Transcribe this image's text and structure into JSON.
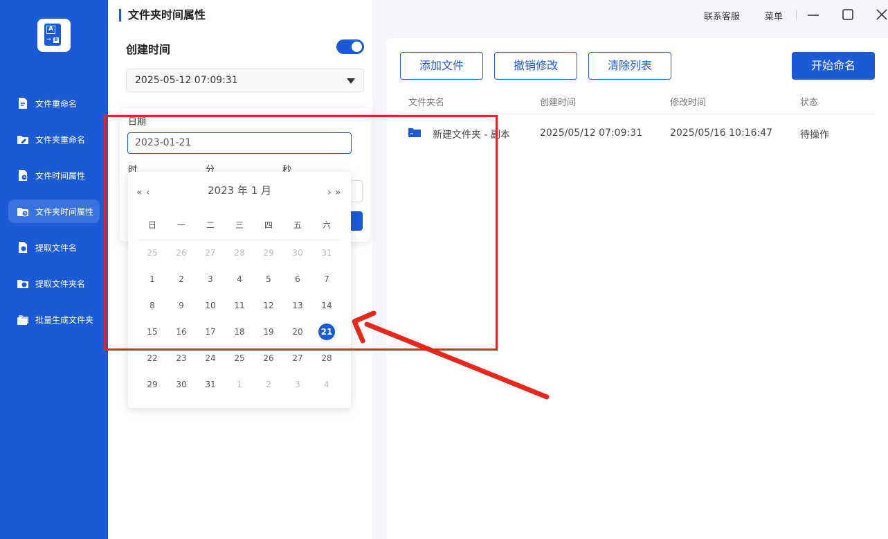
{
  "sidebar": {
    "logo": {
      "top_letter": "A",
      "bottom_letter": "B",
      "arrow": "→"
    },
    "items": [
      {
        "label": "文件重命名",
        "icon": "file-edit-icon"
      },
      {
        "label": "文件夹重命名",
        "icon": "folder-edit-icon"
      },
      {
        "label": "文件时间属性",
        "icon": "file-clock-icon"
      },
      {
        "label": "文件夹时间属性",
        "icon": "folder-clock-icon",
        "active": true
      },
      {
        "label": "提取文件名",
        "icon": "file-extract-icon"
      },
      {
        "label": "提取文件夹名",
        "icon": "folder-extract-icon"
      },
      {
        "label": "批量生成文件夹",
        "icon": "folders-icon"
      }
    ]
  },
  "mid": {
    "title": "文件夹时间属性",
    "section_label": "创建时间",
    "toggle_on": true,
    "select_value": "2025-05-12 07:09:31"
  },
  "popover": {
    "date_label": "日期",
    "date_value": "2023-01-21",
    "hour_label": "时",
    "minute_label": "分",
    "second_label": "秒"
  },
  "calendar": {
    "header": "2023 年  1 月",
    "prev_year": "«",
    "prev_month": "‹",
    "next_month": "›",
    "next_year": "»",
    "weekdays": [
      "日",
      "一",
      "二",
      "三",
      "四",
      "五",
      "六"
    ],
    "weeks": [
      [
        {
          "d": "25",
          "dim": true
        },
        {
          "d": "26",
          "dim": true
        },
        {
          "d": "27",
          "dim": true
        },
        {
          "d": "28",
          "dim": true
        },
        {
          "d": "29",
          "dim": true
        },
        {
          "d": "30",
          "dim": true
        },
        {
          "d": "31",
          "dim": true
        }
      ],
      [
        {
          "d": "1"
        },
        {
          "d": "2"
        },
        {
          "d": "3"
        },
        {
          "d": "4"
        },
        {
          "d": "5"
        },
        {
          "d": "6"
        },
        {
          "d": "7"
        }
      ],
      [
        {
          "d": "8"
        },
        {
          "d": "9"
        },
        {
          "d": "10"
        },
        {
          "d": "11"
        },
        {
          "d": "12"
        },
        {
          "d": "13"
        },
        {
          "d": "14"
        }
      ],
      [
        {
          "d": "15"
        },
        {
          "d": "16"
        },
        {
          "d": "17"
        },
        {
          "d": "18"
        },
        {
          "d": "19"
        },
        {
          "d": "20"
        },
        {
          "d": "21",
          "sel": true
        }
      ],
      [
        {
          "d": "22"
        },
        {
          "d": "23"
        },
        {
          "d": "24"
        },
        {
          "d": "25"
        },
        {
          "d": "26"
        },
        {
          "d": "27"
        },
        {
          "d": "28"
        }
      ],
      [
        {
          "d": "29"
        },
        {
          "d": "30"
        },
        {
          "d": "31"
        },
        {
          "d": "1",
          "dim": true
        },
        {
          "d": "2",
          "dim": true
        },
        {
          "d": "3",
          "dim": true
        },
        {
          "d": "4",
          "dim": true
        }
      ]
    ]
  },
  "topbar": {
    "support": "联系客服",
    "menu": "菜单"
  },
  "toolbar": {
    "add_files": "添加文件",
    "undo_changes": "撤销修改",
    "clear_list": "清除列表",
    "start_rename": "开始命名"
  },
  "table": {
    "headers": {
      "name": "文件夹名",
      "created": "创建时间",
      "modified": "修改时间",
      "status": "状态"
    },
    "rows": [
      {
        "name": "新建文件夹 - 副本",
        "created": "2025/05/12 07:09:31",
        "modified": "2025/05/16 10:16:47",
        "status": "待操作"
      }
    ]
  },
  "colors": {
    "brand": "#1a5ad6",
    "annotation": "#e8271c"
  }
}
